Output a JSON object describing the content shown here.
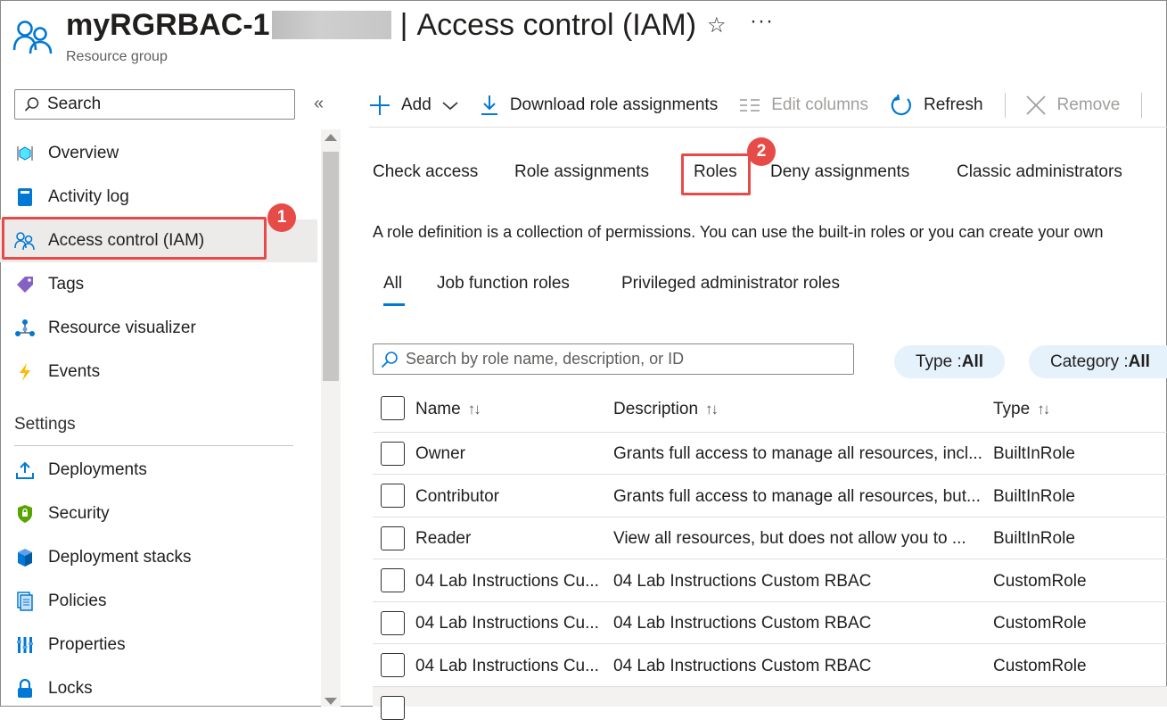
{
  "header": {
    "resource_name": "myRGRBAC-1",
    "separator": "|",
    "page_title": "Access control (IAM)",
    "subtitle": "Resource group",
    "favorite_icon": "star-icon",
    "more_label": "···"
  },
  "sidebar": {
    "search_placeholder": "Search",
    "collapse_label": "«",
    "items": [
      {
        "label": "Overview",
        "icon": "overview-cube-icon"
      },
      {
        "label": "Activity log",
        "icon": "activity-log-icon"
      },
      {
        "label": "Access control (IAM)",
        "icon": "people-icon",
        "active": true
      },
      {
        "label": "Tags",
        "icon": "tag-icon"
      },
      {
        "label": "Resource visualizer",
        "icon": "visualizer-icon"
      },
      {
        "label": "Events",
        "icon": "lightning-icon"
      }
    ],
    "section_title": "Settings",
    "settings_items": [
      {
        "label": "Deployments",
        "icon": "upload-icon"
      },
      {
        "label": "Security",
        "icon": "shield-icon"
      },
      {
        "label": "Deployment stacks",
        "icon": "stack-icon"
      },
      {
        "label": "Policies",
        "icon": "policy-doc-icon"
      },
      {
        "label": "Properties",
        "icon": "properties-bars-icon"
      },
      {
        "label": "Locks",
        "icon": "lock-icon"
      }
    ]
  },
  "annotations": {
    "step1": "1",
    "step2": "2",
    "color": "#e74b48"
  },
  "toolbar": {
    "add": "Add",
    "download": "Download role assignments",
    "edit_columns": "Edit columns",
    "refresh": "Refresh",
    "remove": "Remove"
  },
  "main_tabs": [
    "Check access",
    "Role assignments",
    "Roles",
    "Deny assignments",
    "Classic administrators"
  ],
  "description": "A role definition is a collection of permissions. You can use the built-in roles or you can create your own",
  "sub_tabs": [
    "All",
    "Job function roles",
    "Privileged administrator roles"
  ],
  "filters": {
    "search_placeholder": "Search by role name, description, or ID",
    "type_label": "Type : ",
    "type_value": "All",
    "category_label": "Category : ",
    "category_value": "All"
  },
  "table": {
    "columns": [
      "Name",
      "Description",
      "Type"
    ],
    "sort_glyph": "↑↓",
    "rows": [
      {
        "name": "Owner",
        "description": "Grants full access to manage all resources, incl...",
        "type": "BuiltInRole"
      },
      {
        "name": "Contributor",
        "description": "Grants full access to manage all resources, but...",
        "type": "BuiltInRole"
      },
      {
        "name": "Reader",
        "description": "View all resources, but does not allow you to ...",
        "type": "BuiltInRole"
      },
      {
        "name": "04 Lab Instructions Cu...",
        "description": "04 Lab Instructions Custom RBAC",
        "type": "CustomRole"
      },
      {
        "name": "04 Lab Instructions Cu...",
        "description": "04 Lab Instructions Custom RBAC",
        "type": "CustomRole"
      },
      {
        "name": "04 Lab Instructions Cu...",
        "description": "04 Lab Instructions Custom RBAC",
        "type": "CustomRole"
      }
    ]
  },
  "colors": {
    "accent": "#0078d4",
    "active_bg": "#edebe9",
    "pill_bg": "#e5f1fb"
  }
}
